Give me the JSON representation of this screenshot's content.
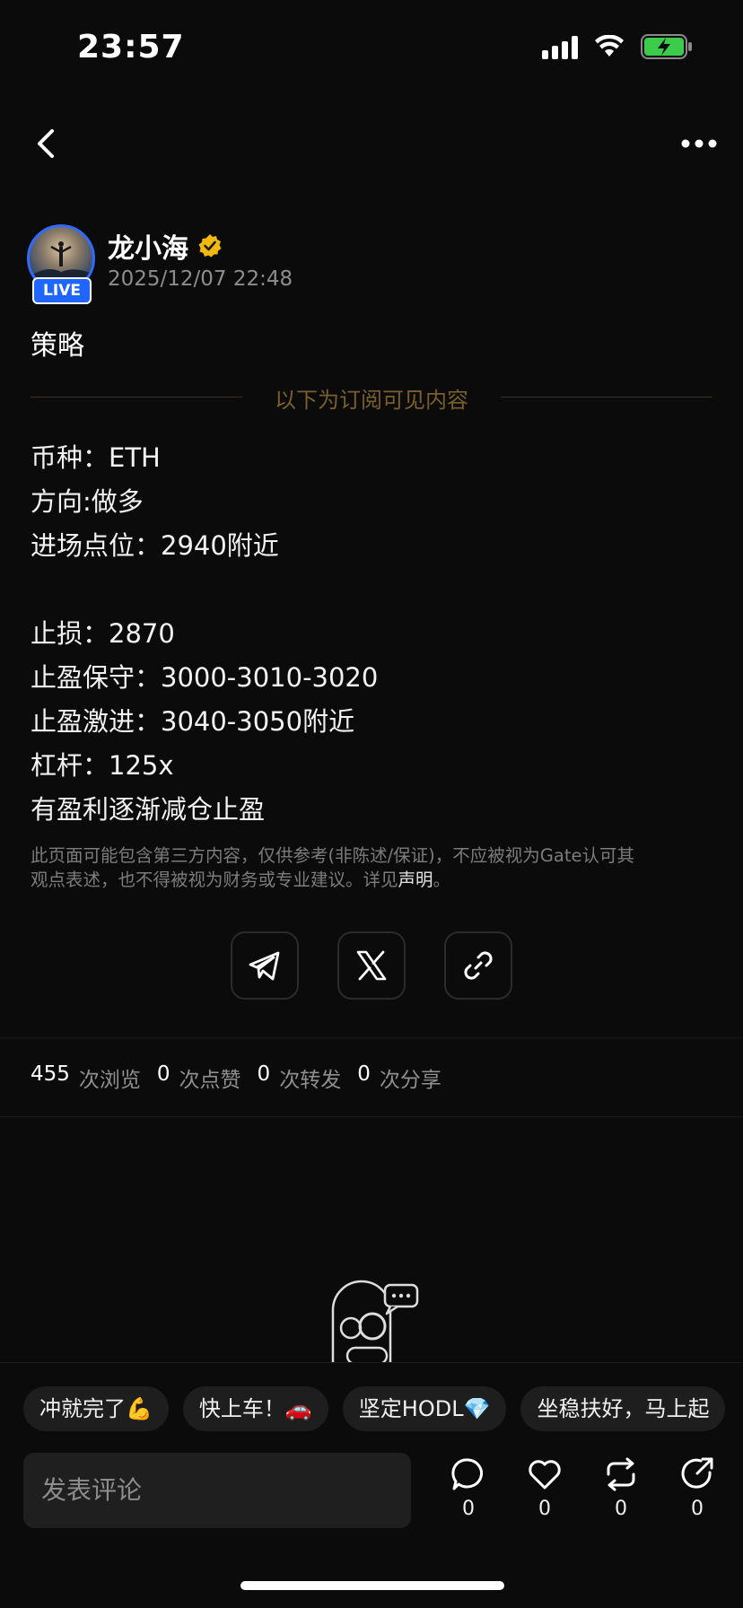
{
  "status": {
    "time": "23:57",
    "icons": [
      "cellular-signal-icon",
      "wifi-icon",
      "battery-charging-icon"
    ],
    "battery_color": "#3ccb4a"
  },
  "nav": {
    "back_icon": "chevron-left-icon",
    "more_icon": "more-horizontal-icon"
  },
  "author": {
    "name": "龙小海",
    "verified_icon": "verified-badge-icon",
    "live_badge": "LIVE",
    "timestamp": "2025/12/07 22:48"
  },
  "post": {
    "title": "策略",
    "subscription_divider": "以下为订阅可见内容",
    "lines": [
      "币种：ETH",
      "方向:做多",
      "进场点位：2940附近",
      "",
      "止损：2870",
      "止盈保守：3000-3010-3020",
      "止盈激进：3040-3050附近",
      "杠杆：125x",
      "有盈利逐渐减仓止盈"
    ],
    "disclaimer_line1": "此页面可能包含第三方内容，仅供参考(非陈述/保证)，不应被视为Gate认可其",
    "disclaimer_line2": "观点表述，也不得被视为财务或专业建议。详见",
    "disclaimer_link": "声明",
    "disclaimer_end": "。"
  },
  "share_buttons": [
    "telegram-icon",
    "x-icon",
    "link-icon"
  ],
  "stats": {
    "views": "455",
    "views_label": "次浏览",
    "likes": "0",
    "likes_label": "次点赞",
    "reposts": "0",
    "reposts_label": "次转发",
    "shares": "0",
    "shares_label": "次分享"
  },
  "quick_replies": [
    "冲就完了💪",
    "快上车！🚗",
    "坚定HODL💎",
    "坐稳扶好，马上起"
  ],
  "comment": {
    "placeholder": "发表评论"
  },
  "actions": {
    "comment_count": "0",
    "like_count": "0",
    "repost_count": "0",
    "share_count": "0"
  },
  "colors": {
    "background": "#0b0b0b",
    "accent_blue": "#1f66ff",
    "verified_gold": "#f0b90b",
    "divider_text": "#7a5f2d"
  }
}
